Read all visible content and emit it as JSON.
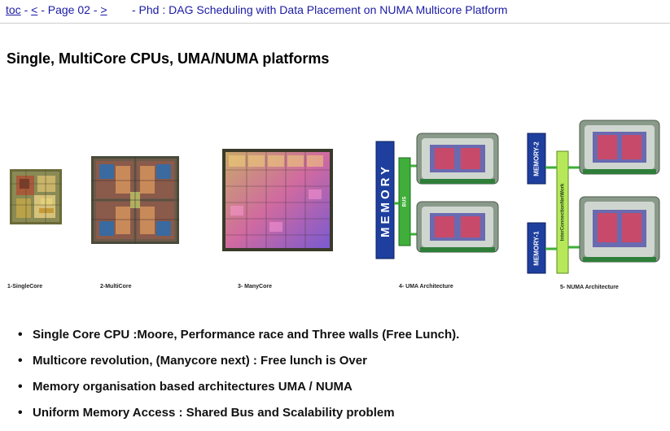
{
  "nav": {
    "toc": "toc",
    "sep1": " - ",
    "prev": "<",
    "page": " - Page 02 - ",
    "next": ">",
    "title": "- Phd : DAG Scheduling with Data Placement on NUMA Multicore Platform"
  },
  "heading": "Single, MultiCore CPUs, UMA/NUMA platforms",
  "figures": {
    "single_core_caption": "1-SingleCore",
    "multicore_caption": "2-MultiCore",
    "manycore_caption": "3- ManyCore",
    "uma_caption": "4- UMA Architecture",
    "numa_caption": "5- NUMA Architecture",
    "uma_memory_label": "MEMORY",
    "uma_bus_label": "BUS",
    "numa_memory2_label": "MEMORY-2",
    "numa_memory1_label": "MEMORY-1",
    "numa_interconnect_label": "InterConnectionNetWork"
  },
  "bullets": [
    "Single Core CPU :Moore, Performance race and Three walls (Free Lunch).",
    "Multicore revolution, (Manycore next) : Free lunch is Over",
    "Memory organisation based architectures UMA / NUMA",
    "Uniform Memory Access : Shared Bus and Scalability problem"
  ],
  "colors": {
    "link": "#1a1aa6",
    "memory_blue": "#1f3f9e",
    "bus_green": "#3fae3a",
    "interconnect_green": "#b7e85a"
  }
}
